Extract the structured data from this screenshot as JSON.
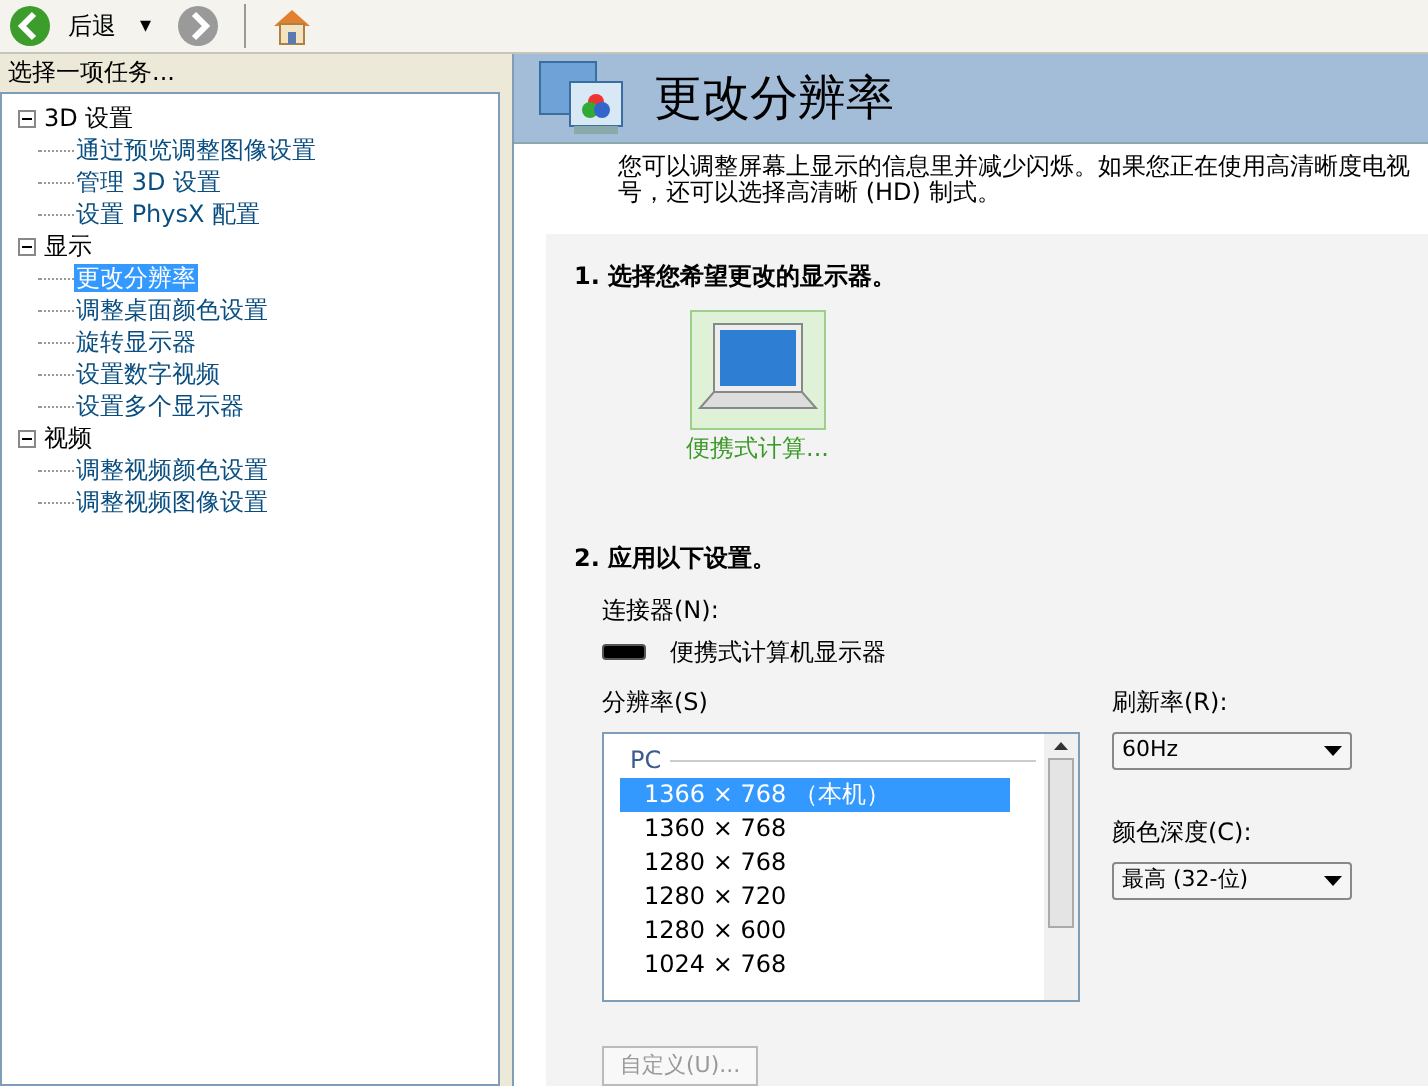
{
  "toolbar": {
    "back_label": "后退",
    "menu_arrow": "▾"
  },
  "sidebar": {
    "title": "选择一项任务...",
    "tree": [
      {
        "label": "3D 设置",
        "expanded": true,
        "children": [
          {
            "label": "通过预览调整图像设置",
            "selected": false
          },
          {
            "label": "管理 3D 设置",
            "selected": false
          },
          {
            "label": "设置 PhysX 配置",
            "selected": false
          }
        ]
      },
      {
        "label": "显示",
        "expanded": true,
        "children": [
          {
            "label": "更改分辨率",
            "selected": true
          },
          {
            "label": "调整桌面颜色设置",
            "selected": false
          },
          {
            "label": "旋转显示器",
            "selected": false
          },
          {
            "label": "设置数字视频",
            "selected": false
          },
          {
            "label": "设置多个显示器",
            "selected": false
          }
        ]
      },
      {
        "label": "视频",
        "expanded": true,
        "children": [
          {
            "label": "调整视频颜色设置",
            "selected": false
          },
          {
            "label": "调整视频图像设置",
            "selected": false
          }
        ]
      }
    ]
  },
  "page": {
    "title": "更改分辨率",
    "description": [
      "您可以调整屏幕上显示的信息里并减少闪烁。如果您正在使用高清晰度电视",
      "号，还可以选择高清晰 (HD) 制式。"
    ]
  },
  "step1": {
    "heading": "1. 选择您希望更改的显示器。",
    "displays": [
      {
        "label": "便携式计算...",
        "selected": true
      }
    ]
  },
  "step2": {
    "heading": "2. 应用以下设置。",
    "connector_label": "连接器(N):",
    "connector_value": "便携式计算机显示器",
    "resolution_label": "分辨率(S)",
    "resolution_group": "PC",
    "resolutions": [
      {
        "label": "1366 × 768 （本机）",
        "selected": true
      },
      {
        "label": "1360 × 768",
        "selected": false
      },
      {
        "label": "1280 × 768",
        "selected": false
      },
      {
        "label": "1280 × 720",
        "selected": false
      },
      {
        "label": "1280 × 600",
        "selected": false
      },
      {
        "label": "1024 × 768",
        "selected": false
      }
    ],
    "refresh_label": "刷新率(R):",
    "refresh_value": "60Hz",
    "depth_label": "颜色深度(C):",
    "depth_value": "最高 (32-位)",
    "custom_button": "自定义(U)..."
  }
}
